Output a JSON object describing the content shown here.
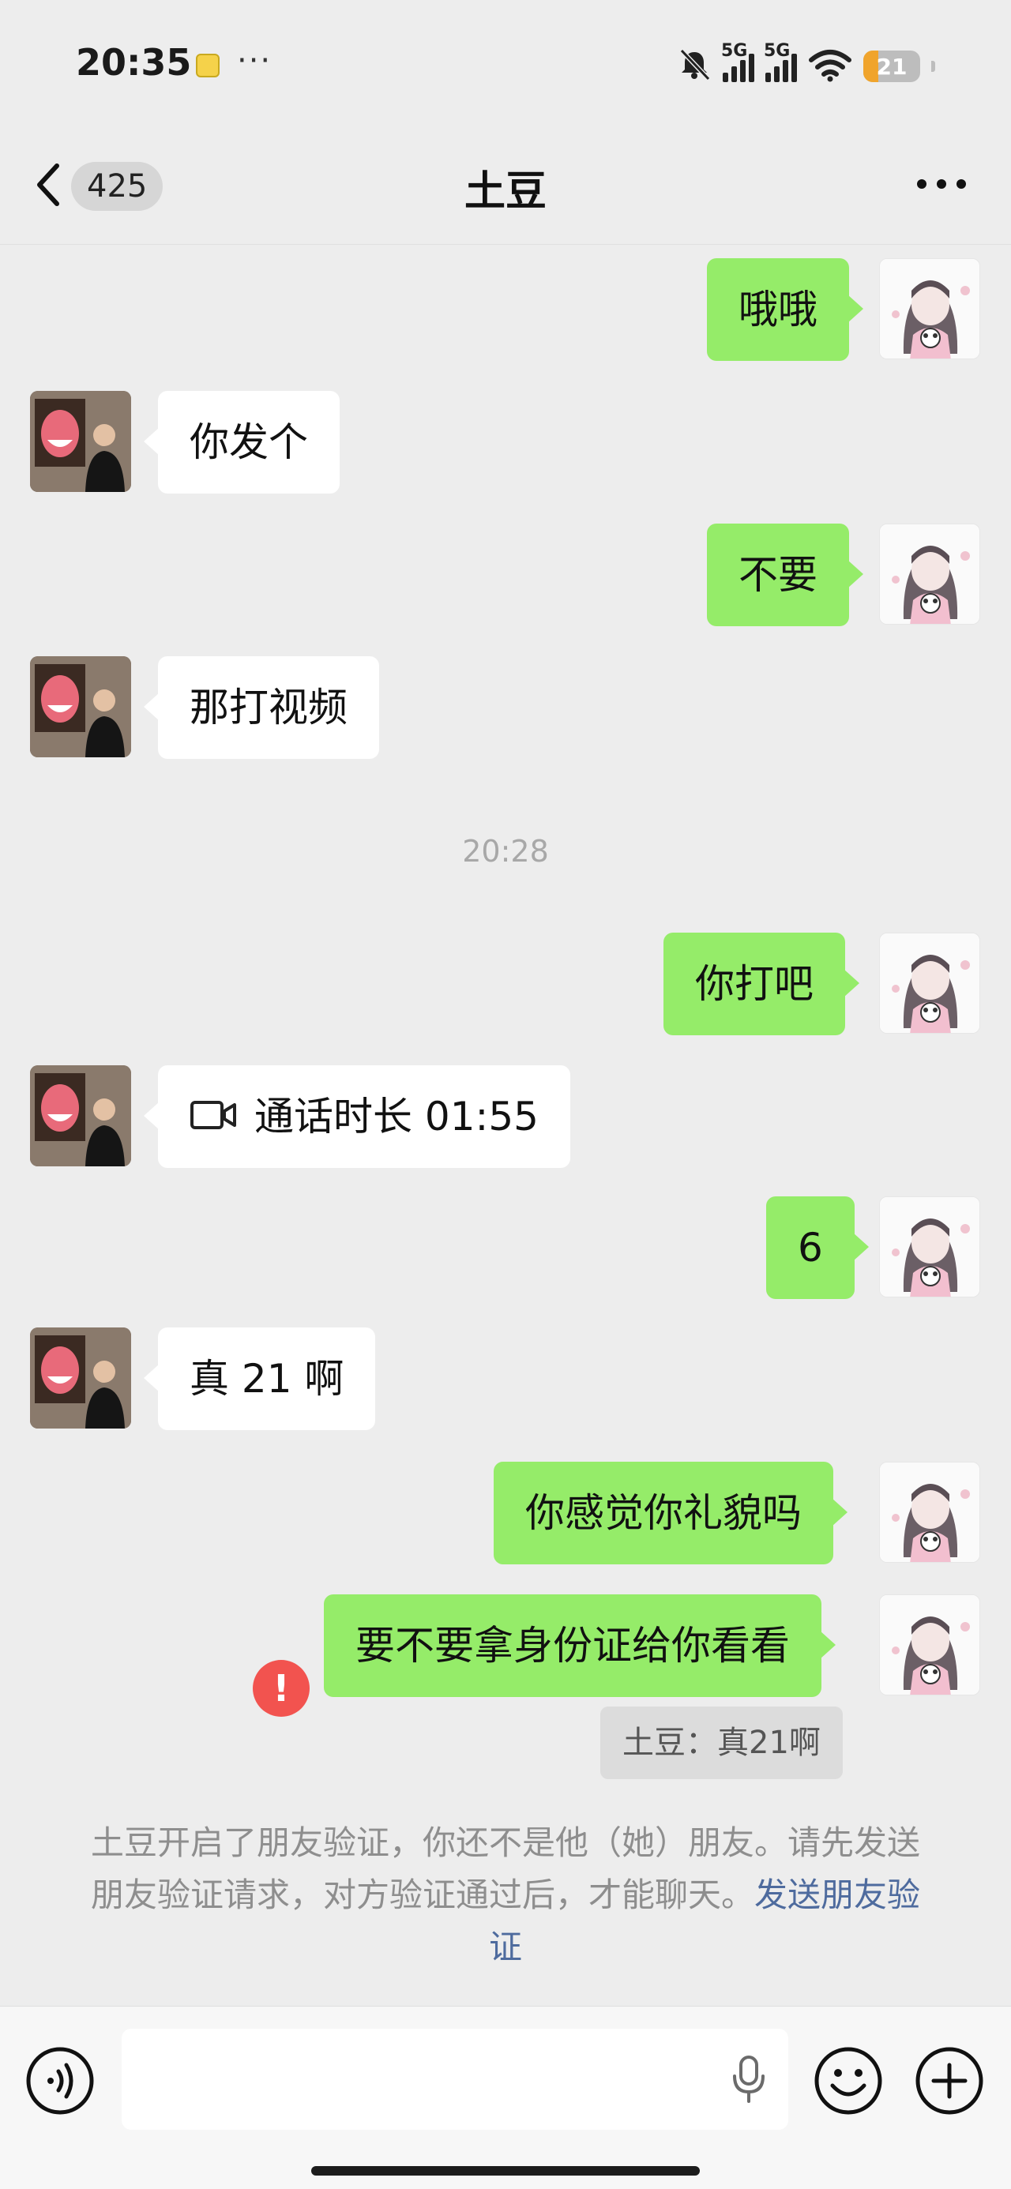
{
  "status_bar": {
    "time": "20:35",
    "dots": "···",
    "network_1": "5G",
    "network_2": "5G",
    "battery_level": "21"
  },
  "nav": {
    "unread_count": "425",
    "title": "土豆"
  },
  "chat": {
    "timestamp": "20:28",
    "messages": [
      {
        "side": "out",
        "text": "哦哦"
      },
      {
        "side": "in",
        "text": "你发个"
      },
      {
        "side": "out",
        "text": "不要"
      },
      {
        "side": "in",
        "text": "那打视频"
      },
      {
        "side": "out",
        "text": "你打吧"
      },
      {
        "side": "in",
        "text": "通话时长 01:55",
        "icon": "video-call-icon"
      },
      {
        "side": "out",
        "text": "6"
      },
      {
        "side": "in",
        "text": "真 21 啊"
      },
      {
        "side": "out",
        "text": "你感觉你礼貌吗"
      },
      {
        "side": "out",
        "text": "要不要拿身份证给你看看",
        "status": "failed"
      }
    ],
    "error_mark": "!",
    "quote": "土豆：真21啊"
  },
  "notice": {
    "text": "土豆开启了朋友验证，你还不是他（她）朋友。请先发送朋友验证请求，对方验证通过后，才能聊天。",
    "link": "发送朋友验证"
  },
  "colors": {
    "bubble_out": "#95ec69",
    "bubble_in": "#ffffff",
    "background": "#ededed",
    "link": "#4e6b9e",
    "error": "#f2534f"
  }
}
